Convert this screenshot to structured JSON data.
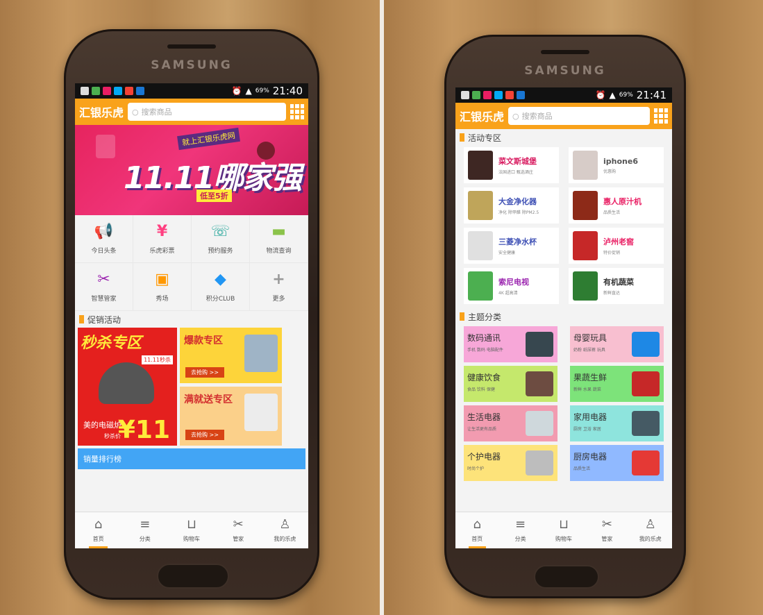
{
  "left": {
    "brand": "SAMSUNG",
    "status": {
      "battery": "69%",
      "time": "21:40"
    },
    "topbar": {
      "logo": "汇银乐虎",
      "search_placeholder": "搜索商品"
    },
    "banner": {
      "headline": "11.11哪家强",
      "tag_top": "就上汇银乐虎网",
      "tag_bottom": "低至5折"
    },
    "grid": [
      {
        "label": "今日头条",
        "icon": "megaphone-icon",
        "color": "#f44336"
      },
      {
        "label": "乐虎彩票",
        "icon": "ticket-icon",
        "color": "#ff4081"
      },
      {
        "label": "预约服务",
        "icon": "phone-icon",
        "color": "#26a69a"
      },
      {
        "label": "物流查询",
        "icon": "truck-icon",
        "color": "#8bc34a"
      },
      {
        "label": "智慧管家",
        "icon": "wrench-icon",
        "color": "#9c27b0"
      },
      {
        "label": "秀场",
        "icon": "photos-icon",
        "color": "#ff9800"
      },
      {
        "label": "积分CLUB",
        "icon": "diamond-icon",
        "color": "#2196f3"
      },
      {
        "label": "更多",
        "icon": "plus-icon",
        "color": "#999999"
      }
    ],
    "promo_section": "促销活动",
    "promo": {
      "seckill_title": "秒杀专区",
      "seckill_date": "11.11秒杀",
      "seckill_item": "美的电磁炉",
      "seckill_sub": "秒杀价",
      "seckill_price": "¥11",
      "hot_title": "爆款专区",
      "hot_button": "去抢购 >>",
      "gift_title": "满就送专区",
      "gift_button": "去抢购 >>"
    },
    "ranking": "销量排行榜"
  },
  "right": {
    "brand": "SAMSUNG",
    "status": {
      "battery": "69%",
      "time": "21:41"
    },
    "topbar": {
      "logo": "汇银乐虎",
      "search_placeholder": "搜索商品"
    },
    "activity_section": "活动专区",
    "activities": [
      {
        "name": "菜文斯城堡",
        "sub": "法国进口 甄选酒庄",
        "color": "#d81b60",
        "img": "#3e2723"
      },
      {
        "name": "iphone6",
        "sub": "优惠购",
        "color": "#555555",
        "img": "#d7ccc8"
      },
      {
        "name": "大金净化器",
        "sub": "净化 除甲醛 除PM2.5",
        "color": "#3f51b5",
        "img": "#bfa55a"
      },
      {
        "name": "惠人原汁机",
        "sub": "品质生活",
        "color": "#e91e63",
        "img": "#8d2a18"
      },
      {
        "name": "三菱净水杯",
        "sub": "安全健康",
        "color": "#3f51b5",
        "img": "#e0e0e0"
      },
      {
        "name": "泸州老窖",
        "sub": "特价促销",
        "color": "#e91e63",
        "img": "#c62828"
      },
      {
        "name": "索尼电视",
        "sub": "4K 超高清",
        "color": "#9c27b0",
        "img": "#4caf50"
      },
      {
        "name": "有机蔬菜",
        "sub": "新鲜直达",
        "color": "#333333",
        "img": "#2e7d32"
      }
    ],
    "theme_section": "主题分类",
    "themes": [
      {
        "name": "数码通讯",
        "sub": "手机 数码 电脑配件",
        "bg": "#f7a7d8",
        "pic": "#37474f"
      },
      {
        "name": "母婴玩具",
        "sub": "奶粉 纸尿裤 玩具",
        "bg": "#f8bfd0",
        "pic": "#1e88e5"
      },
      {
        "name": "健康饮食",
        "sub": "食品 饮料 保健",
        "bg": "#c5e86c",
        "pic": "#6d4c41"
      },
      {
        "name": "果蔬生鲜",
        "sub": "新鲜 水果 蔬菜",
        "bg": "#7de37a",
        "pic": "#c62828"
      },
      {
        "name": "生活电器",
        "sub": "让生活更有品质",
        "bg": "#f29bb0",
        "pic": "#cfd8dc"
      },
      {
        "name": "家用电器",
        "sub": "厨房 卫浴 家居",
        "bg": "#8ee4dd",
        "pic": "#455a64"
      },
      {
        "name": "个护电器",
        "sub": "时尚个护",
        "bg": "#fde37a",
        "pic": "#bdbdbd"
      },
      {
        "name": "厨房电器",
        "sub": "品质生活",
        "bg": "#90b9ff",
        "pic": "#e53935"
      }
    ]
  },
  "tabs": [
    {
      "label": "首页",
      "icon": "home-icon"
    },
    {
      "label": "分类",
      "icon": "list-icon"
    },
    {
      "label": "购物车",
      "icon": "cart-icon"
    },
    {
      "label": "管家",
      "icon": "wrench-icon"
    },
    {
      "label": "我的乐虎",
      "icon": "user-icon"
    }
  ]
}
